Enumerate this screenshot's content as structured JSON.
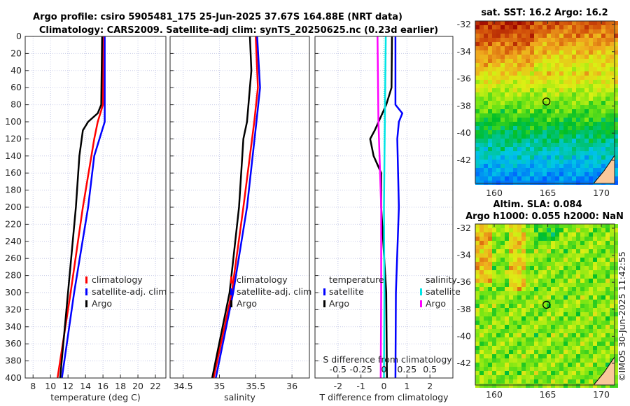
{
  "title": {
    "line1": "Argo profile: csiro 5905481_175 25-Jun-2025 37.67S 164.88E (NRT data)",
    "line2": "Climatology: CARS2009. Satellite-adj clim: synTS_20250625.nc (0.23d earlier)"
  },
  "maps": {
    "sst_title": "sat. SST: 16.2 Argo: 16.2",
    "sla_title1": "Altim. SLA: 0.084",
    "sla_title2": "Argo h1000: 0.055 h2000: NaN",
    "lat_ticks": [
      "-32",
      "-34",
      "-36",
      "-38",
      "-40",
      "-42"
    ],
    "lon_ticks": [
      "160",
      "165",
      "170"
    ],
    "land_color": "#f9c89b",
    "argo_position": {
      "lon": 164.88,
      "lat": -37.67
    }
  },
  "copyright": "©IMOS 30-Jun-2025 11:42:55",
  "chart_data": [
    {
      "type": "line",
      "xlabel": "temperature (deg C)",
      "ylabel": "",
      "xlim": [
        7.1,
        23.2
      ],
      "ylim": [
        400,
        0
      ],
      "xticks": [
        "8",
        "10",
        "12",
        "14",
        "16",
        "18",
        "20",
        "22"
      ],
      "yticks": [
        "0",
        "20",
        "40",
        "60",
        "80",
        "100",
        "120",
        "140",
        "160",
        "180",
        "200",
        "220",
        "240",
        "260",
        "280",
        "300",
        "320",
        "340",
        "360",
        "380",
        "400"
      ],
      "grid": true,
      "legend": "bottom-right",
      "series": [
        {
          "name": "climatology",
          "color": "#ff0000",
          "depth": [
            0,
            80,
            100,
            120,
            200,
            300,
            400
          ],
          "values": [
            16.0,
            16.0,
            15.4,
            15.0,
            13.7,
            12.3,
            10.8
          ]
        },
        {
          "name": "satellite-adj. clim",
          "color": "#0000ff",
          "depth": [
            0,
            100,
            120,
            140,
            200,
            300,
            400
          ],
          "values": [
            16.2,
            16.2,
            15.6,
            15.0,
            14.3,
            12.7,
            11.3
          ]
        },
        {
          "name": "Argo",
          "color": "#000000",
          "depth": [
            0,
            80,
            90,
            100,
            110,
            140,
            200,
            300,
            400
          ],
          "values": [
            15.9,
            15.8,
            15.4,
            14.3,
            13.7,
            13.3,
            12.9,
            12.0,
            11.1
          ]
        }
      ]
    },
    {
      "type": "line",
      "xlabel": "salinity",
      "ylabel": "",
      "xlim": [
        34.32,
        36.24
      ],
      "ylim": [
        400,
        0
      ],
      "xticks": [
        "34.5",
        "35",
        "35.5",
        "36"
      ],
      "grid": true,
      "legend": "bottom-right",
      "series": [
        {
          "name": "climatology",
          "color": "#ff0000",
          "depth": [
            0,
            60,
            100,
            200,
            300,
            400
          ],
          "values": [
            35.5,
            35.53,
            35.48,
            35.33,
            35.17,
            34.92
          ]
        },
        {
          "name": "satellite-adj. clim",
          "color": "#0000ff",
          "depth": [
            0,
            60,
            100,
            200,
            300,
            400
          ],
          "values": [
            35.52,
            35.56,
            35.51,
            35.38,
            35.19,
            34.95
          ]
        },
        {
          "name": "Argo",
          "color": "#000000",
          "depth": [
            0,
            40,
            100,
            120,
            200,
            300,
            400
          ],
          "values": [
            35.42,
            35.44,
            35.38,
            35.33,
            35.27,
            35.14,
            34.9
          ]
        }
      ]
    },
    {
      "type": "line",
      "xlabel": "T difference from climatology",
      "x2label": "S difference from climatology",
      "xlim": [
        -3,
        3
      ],
      "x2lim": [
        -0.75,
        0.75
      ],
      "ylim": [
        400,
        0
      ],
      "xticks": [
        "-2",
        "-1",
        "0",
        "1",
        "2"
      ],
      "x2ticks": [
        "-0.5",
        "-0.25",
        "0",
        "0.25",
        "0.5"
      ],
      "grid": true,
      "legend_headers": [
        "temperature",
        "salinity"
      ],
      "series": [
        {
          "name": "satellite",
          "group": "temperature",
          "axis": "T",
          "color": "#0000ff",
          "depth": [
            0,
            80,
            90,
            100,
            120,
            200,
            300,
            400
          ],
          "values": [
            0.5,
            0.5,
            0.8,
            0.65,
            0.58,
            0.65,
            0.52,
            0.5
          ]
        },
        {
          "name": "Argo",
          "group": "temperature",
          "axis": "T",
          "color": "#000000",
          "depth": [
            0,
            60,
            80,
            110,
            120,
            140,
            160,
            200,
            300,
            400
          ],
          "values": [
            0.35,
            0.33,
            0.1,
            -0.4,
            -0.6,
            -0.45,
            -0.12,
            -0.12,
            0.1,
            0.13
          ]
        },
        {
          "name": "satellite",
          "group": "salinity",
          "axis": "S",
          "color": "#00e5e5",
          "depth": [
            0,
            100,
            200,
            300,
            400
          ],
          "values": [
            0.02,
            0.01,
            0.0,
            0.005,
            0.0
          ]
        },
        {
          "name": "Argo",
          "group": "salinity",
          "axis": "S",
          "color": "#ff00ff",
          "depth": [
            0,
            100,
            200,
            300,
            400
          ],
          "values": [
            -0.07,
            -0.06,
            -0.03,
            -0.03,
            -0.035
          ]
        }
      ]
    }
  ]
}
